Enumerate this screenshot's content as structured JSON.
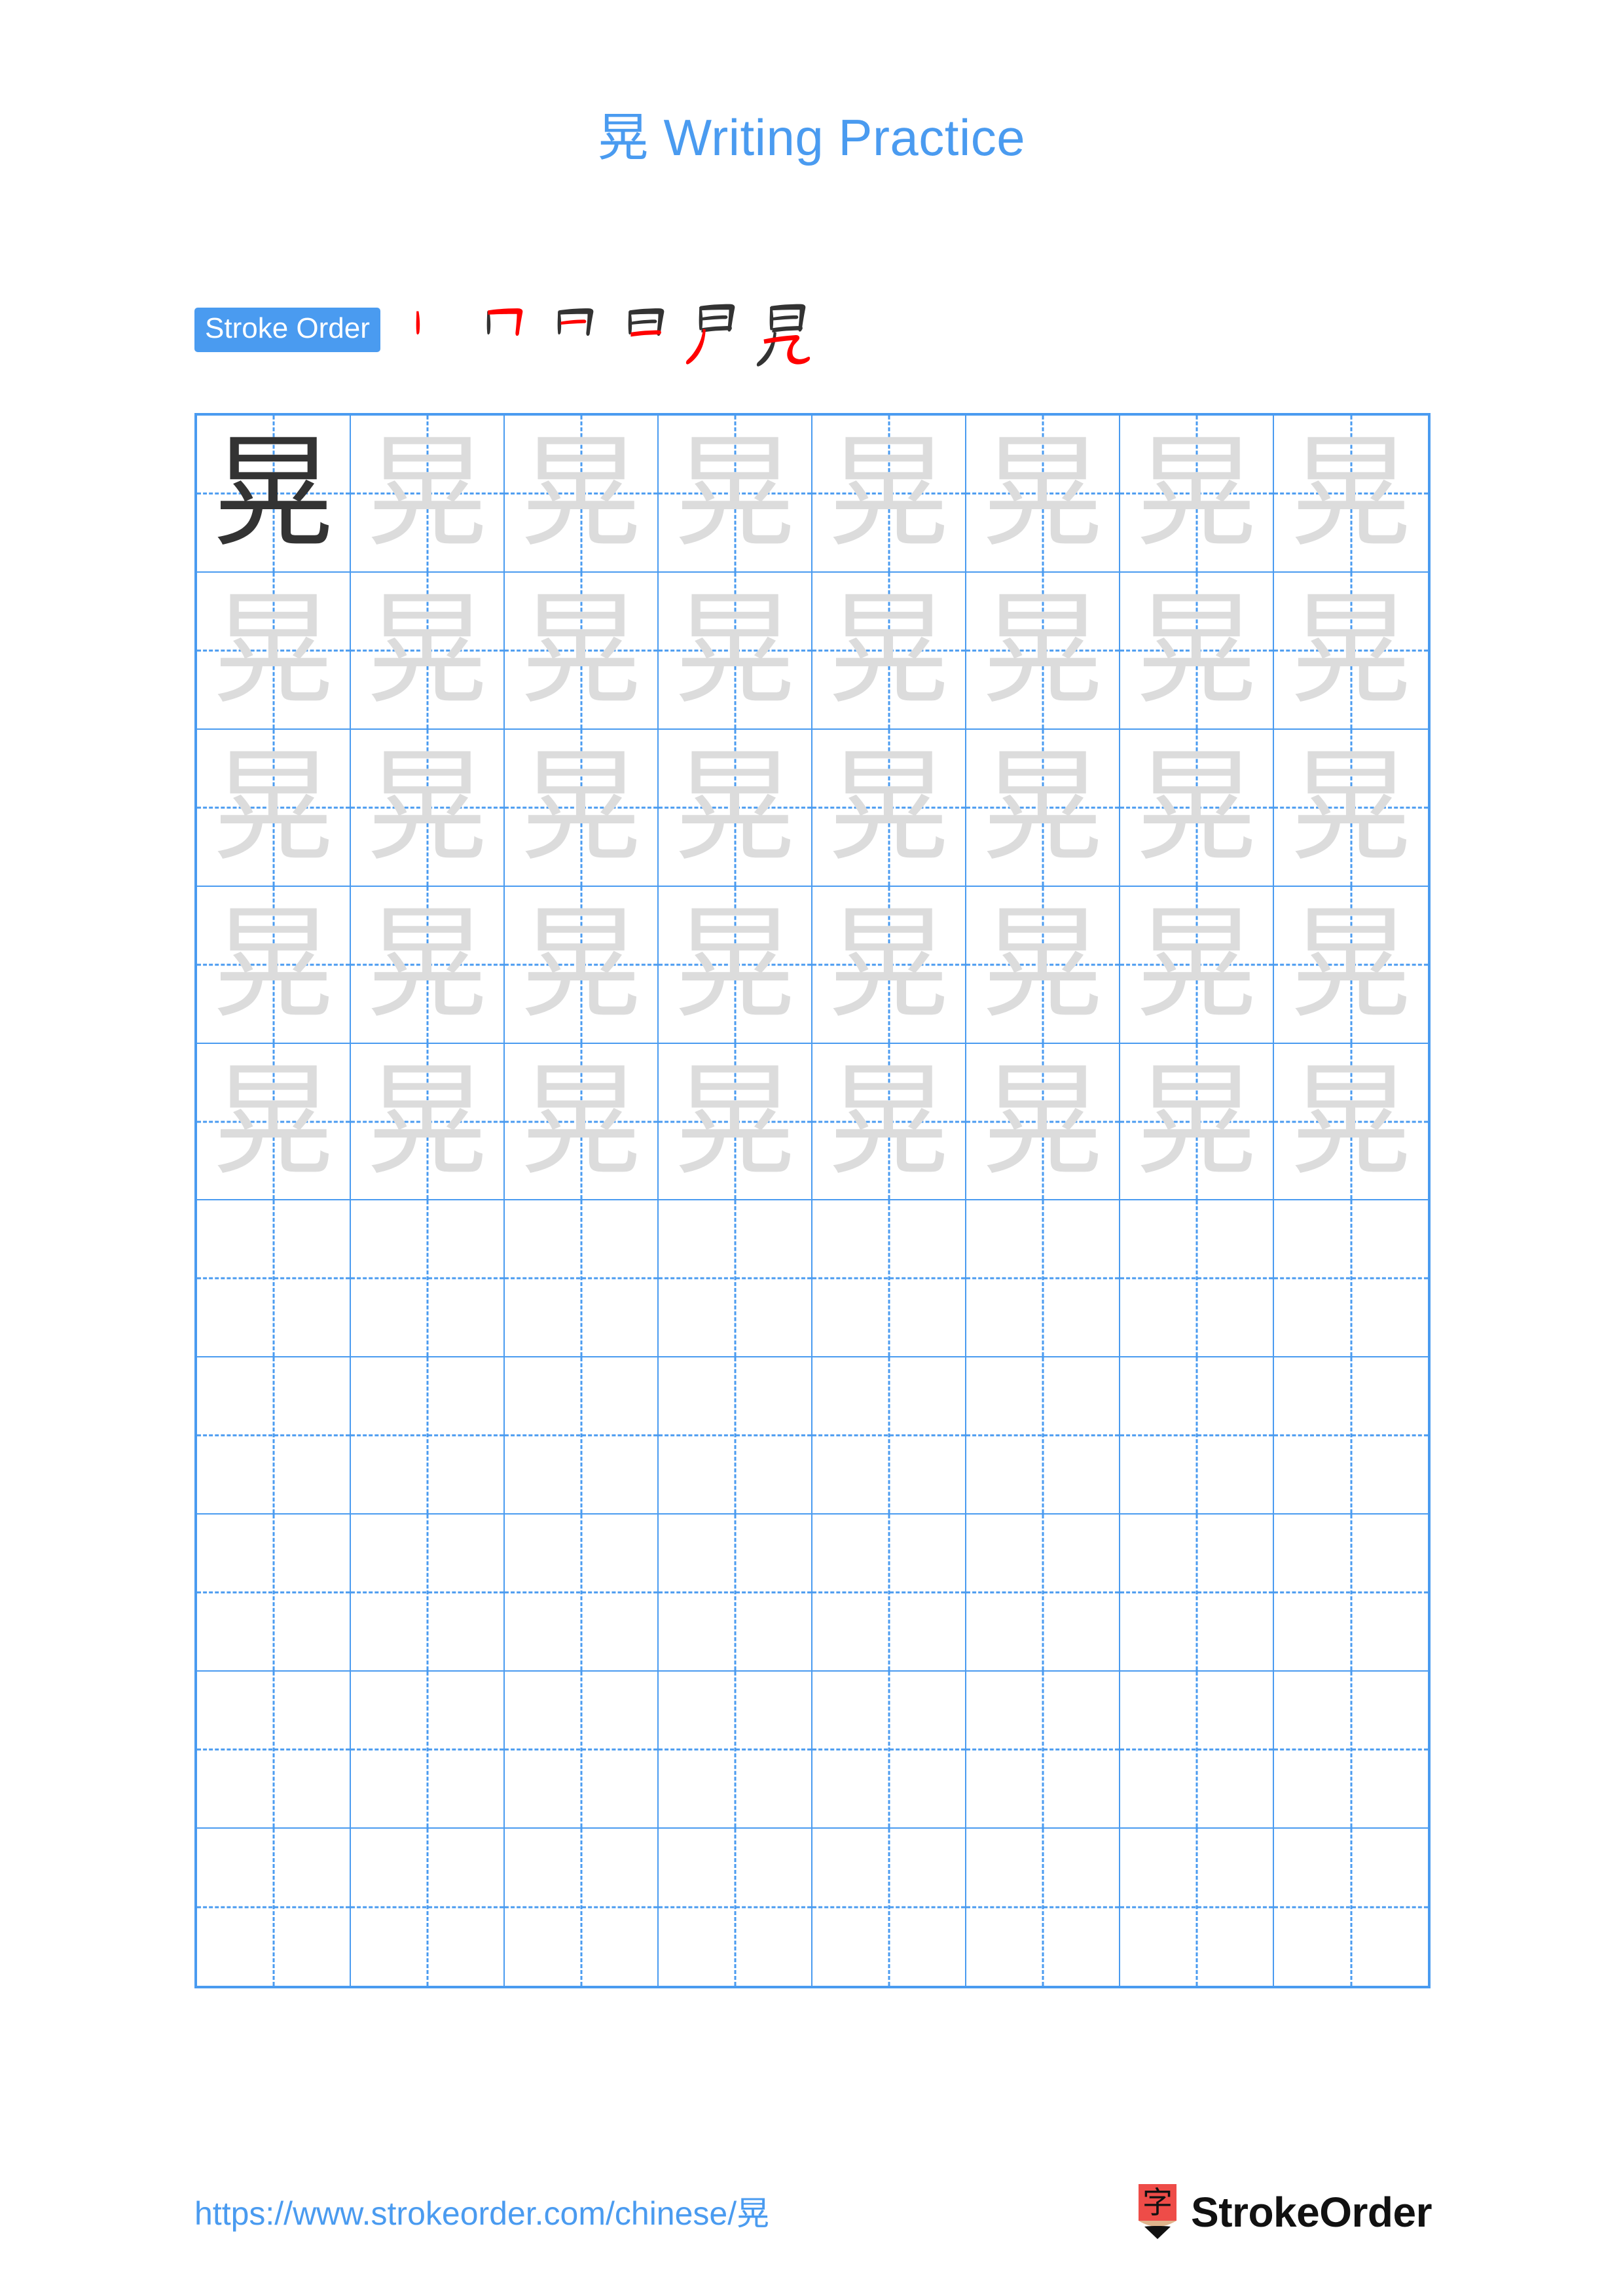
{
  "character": "晃",
  "title": {
    "character": "晃",
    "text": " Writing Practice",
    "full": "晃 Writing Practice",
    "color": "#4a9bf0"
  },
  "stroke_order": {
    "badge_label": "Stroke Order",
    "badge_bg": "#4a9bf0",
    "badge_text_color": "#ffffff",
    "new_stroke_color": "#ff0000",
    "old_stroke_color": "#333333",
    "total_strokes": 6,
    "steps": [
      {
        "index": 1,
        "glyph": "丨",
        "description": "vertical stroke"
      },
      {
        "index": 2,
        "glyph": "冂",
        "description": "horizontal-turn-vertical added"
      },
      {
        "index": 3,
        "glyph": "日",
        "description": "inner horizontal added"
      },
      {
        "index": 4,
        "glyph": "日",
        "description": "bottom horizontal closes the box"
      },
      {
        "index": 5,
        "glyph": "尹",
        "description": "long left-falling stroke added"
      },
      {
        "index": 6,
        "glyph": "晃",
        "description": "final hooked stroke completes the character"
      }
    ]
  },
  "grid": {
    "columns": 8,
    "rows": 10,
    "filled_rows": 5,
    "empty_rows": 5,
    "line_color": "#4a9bf0",
    "model_char_color": "#333333",
    "trace_char_color": "#dcdcdc",
    "model_cell": {
      "row": 1,
      "column": 1
    }
  },
  "footer": {
    "url": "https://www.strokeorder.com/chinese/晃",
    "url_color": "#4a9bf0",
    "logo": {
      "brand": "StrokeOrder",
      "mark_character": "字",
      "mark_body_color": "#ee4c48",
      "mark_wood_color": "#dfb48c",
      "mark_tip_color": "#111111",
      "text_color": "#111111"
    }
  }
}
